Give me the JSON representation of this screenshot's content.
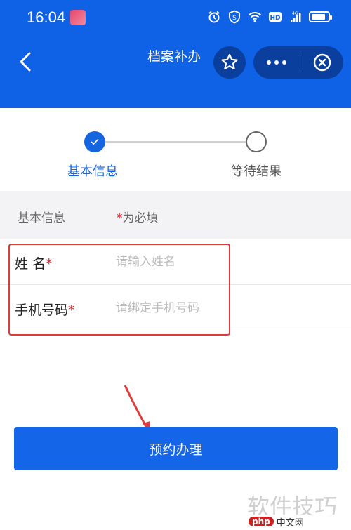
{
  "status_bar": {
    "time": "16:04",
    "icons": [
      "alarm-icon",
      "shield-s-icon",
      "wifi-icon",
      "hd-icon",
      "signal-4g-icon",
      "battery-icon"
    ],
    "battery_level": 0.85
  },
  "header": {
    "title": "档案补办",
    "back_icon": "chevron-left-icon",
    "favorite_icon": "star-outline-icon",
    "more_icon": "more-dots-icon",
    "close_icon": "close-circle-icon"
  },
  "steps": [
    {
      "label": "基本信息",
      "state": "active"
    },
    {
      "label": "等待结果",
      "state": "pending"
    }
  ],
  "section": {
    "title": "基本信息",
    "required_star": "*",
    "required_note": "为必填"
  },
  "form": {
    "name": {
      "label": "姓 名",
      "star": "*",
      "placeholder": "请输入姓名",
      "value": ""
    },
    "phone": {
      "label": "手机号码",
      "star": "*",
      "placeholder": "请绑定手机号码",
      "value": ""
    }
  },
  "submit": {
    "label": "预约办理"
  },
  "watermark": {
    "text": "软件技巧",
    "logo_mark": "php",
    "logo_text": "中文网"
  },
  "colors": {
    "primary": "#0f62e6",
    "button": "#1465e8",
    "required": "#d8232a",
    "annotation": "#e23a3a"
  }
}
